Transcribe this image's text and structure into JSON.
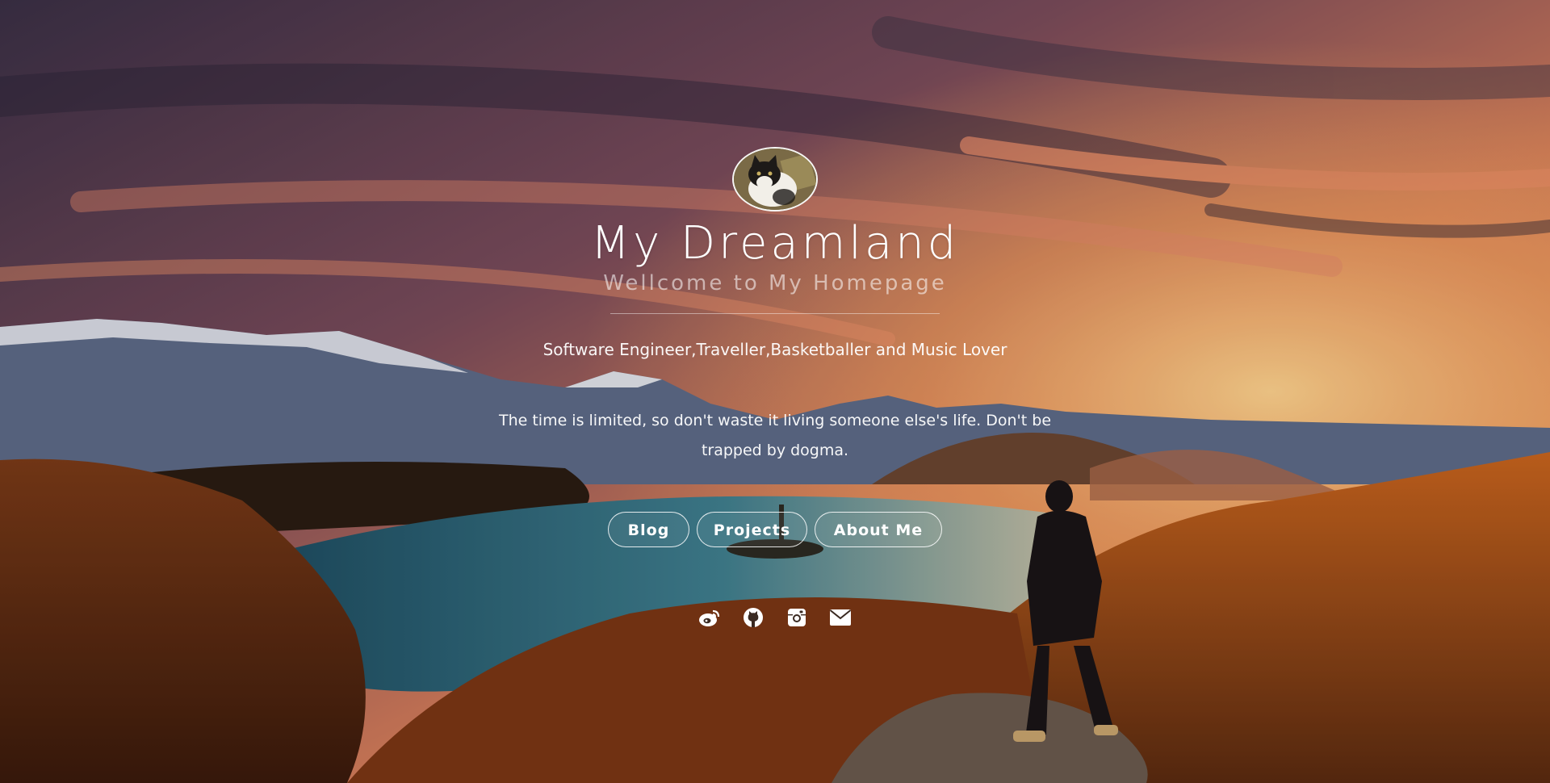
{
  "header": {
    "title": "My Dreamland",
    "subtitle": "Wellcome to My Homepage",
    "tagline": "Software Engineer,Traveller,Basketballer and Music Lover",
    "quote": "The time is limited, so don't waste it living someone else's life. Don't be trapped by dogma."
  },
  "nav": {
    "blog_label": "Blog",
    "projects_label": "Projects",
    "about_label": "About Me"
  },
  "socials": [
    {
      "icon": "weibo-icon"
    },
    {
      "icon": "github-icon"
    },
    {
      "icon": "instagram-icon"
    },
    {
      "icon": "email-icon"
    }
  ],
  "avatar": {
    "icon": "cat-avatar"
  }
}
